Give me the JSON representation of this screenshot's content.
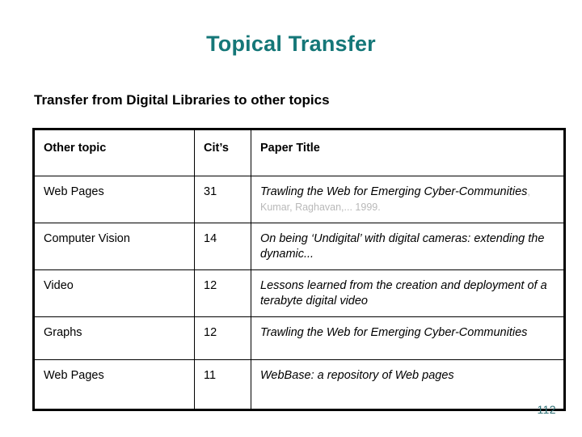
{
  "slide": {
    "title": "Topical Transfer",
    "subtitle": "Transfer from Digital Libraries to other topics",
    "page_number": "112",
    "title_color": "#157778",
    "page_number_color": "#2b6e73",
    "citation_color": "#b9b9b9"
  },
  "table": {
    "headers": {
      "topic": "Other topic",
      "cits": "Cit’s",
      "paper": "Paper Title"
    },
    "rows": [
      {
        "topic": "Web Pages",
        "cits": "31",
        "paper_title": "Trawling the Web for Emerging Cyber-Communities",
        "paper_citation": ", Kumar, Raghavan,... 1999."
      },
      {
        "topic": "Computer Vision",
        "cits": "14",
        "paper_title": "On being ‘Undigital’ with digital cameras: extending the dynamic...",
        "paper_citation": ""
      },
      {
        "topic": "Video",
        "cits": "12",
        "paper_title": "Lessons learned from the creation and deployment of a terabyte digital video",
        "paper_citation": ""
      },
      {
        "topic": "Graphs",
        "cits": "12",
        "paper_title": "Trawling the Web for Emerging Cyber-Communities",
        "paper_citation": ""
      },
      {
        "topic": "Web Pages",
        "cits": "11",
        "paper_title": "WebBase: a repository of Web pages",
        "paper_citation": ""
      }
    ]
  }
}
